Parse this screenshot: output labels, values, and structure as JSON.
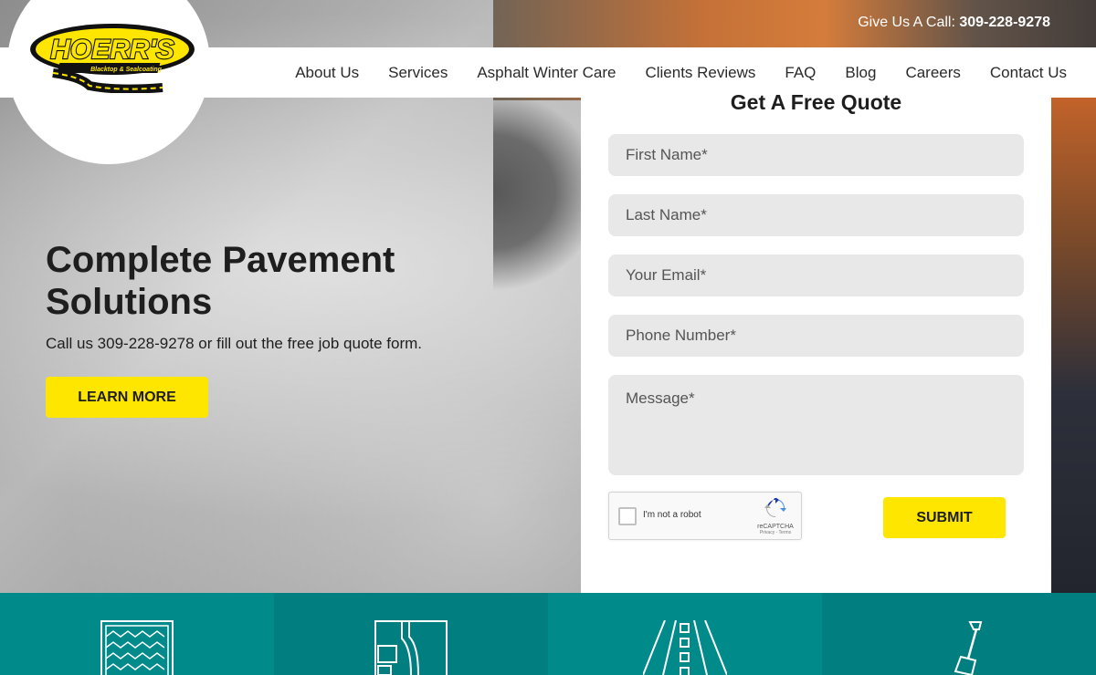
{
  "brand": {
    "name": "HOERR'S",
    "tagline": "Blacktop & Sealcoating"
  },
  "topbar": {
    "call_prefix": "Give Us A Call:",
    "phone": "309-228-9278"
  },
  "nav": {
    "items": [
      {
        "label": "About Us"
      },
      {
        "label": "Services"
      },
      {
        "label": "Asphalt Winter Care"
      },
      {
        "label": "Clients Reviews"
      },
      {
        "label": "FAQ"
      },
      {
        "label": "Blog"
      },
      {
        "label": "Careers"
      },
      {
        "label": "Contact Us"
      }
    ]
  },
  "hero": {
    "title": "Complete Pavement Solutions",
    "subtitle": "Call us 309-228-9278 or fill out the free job quote form.",
    "cta_label": "LEARN MORE"
  },
  "quote_form": {
    "title": "Get A Free Quote",
    "first_name_placeholder": "First Name*",
    "last_name_placeholder": "Last Name*",
    "email_placeholder": "Your Email*",
    "phone_placeholder": "Phone Number*",
    "message_placeholder": "Message*",
    "captcha": {
      "label": "I'm not a robot",
      "brand": "reCAPTCHA",
      "terms": "Privacy - Terms"
    },
    "submit_label": "SUBMIT"
  },
  "colors": {
    "accent_yellow": "#ffe600",
    "teal": "#008a8a",
    "teal_dark": "#007e80",
    "text_dark": "#1e1e1e"
  },
  "services_icons": [
    {
      "icon": "pavers-icon"
    },
    {
      "icon": "parking-lot-icon"
    },
    {
      "icon": "road-icon"
    },
    {
      "icon": "shovel-icon"
    }
  ]
}
